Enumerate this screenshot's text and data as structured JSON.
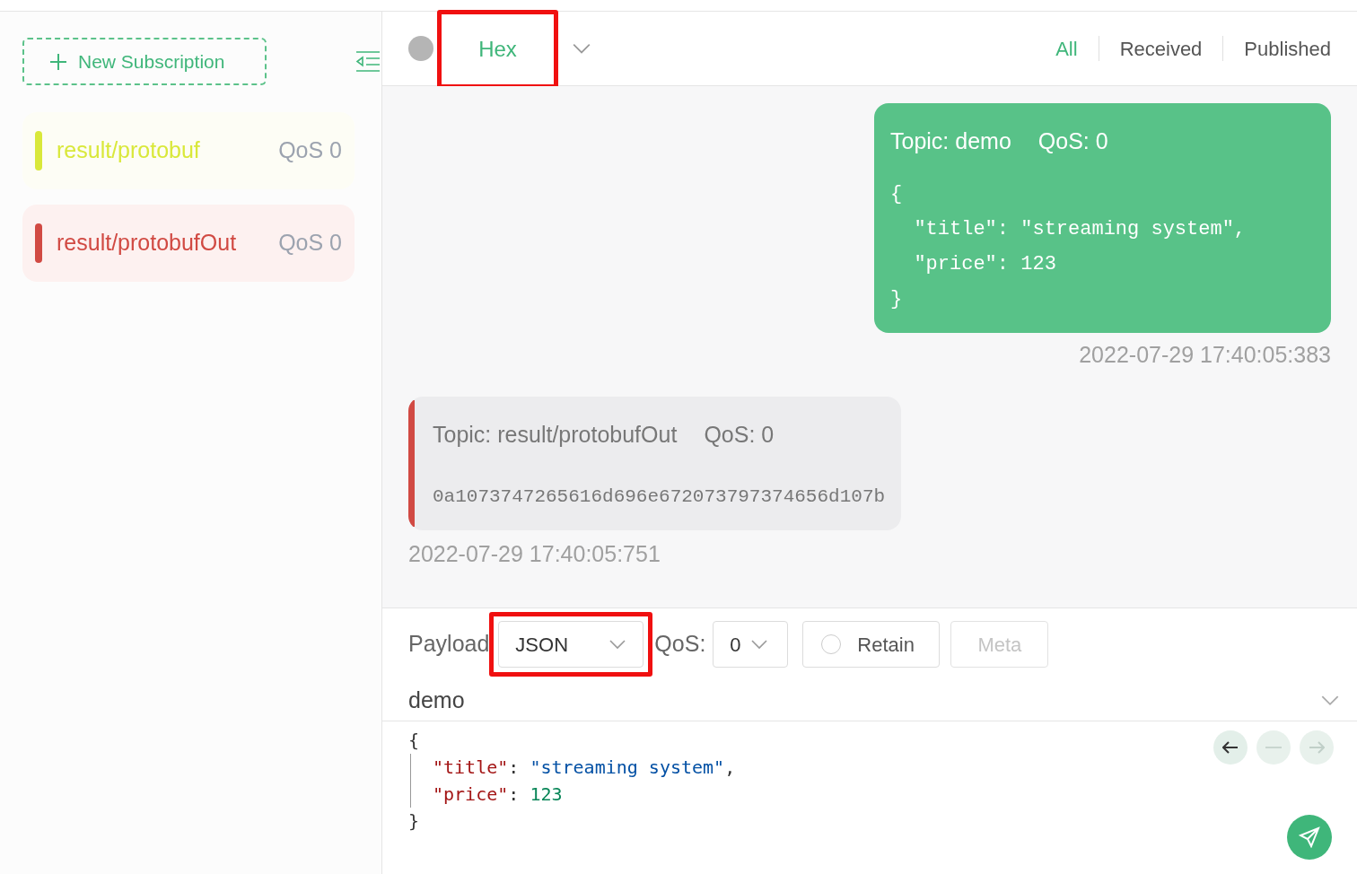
{
  "sidebar": {
    "new_subscription": "New Subscription",
    "subscriptions": [
      {
        "topic": "result/protobuf",
        "qos": "QoS 0",
        "color": "#d9e83a",
        "selected": false
      },
      {
        "topic": "result/protobufOut",
        "qos": "QoS 0",
        "color": "#d14a43",
        "selected": true
      }
    ]
  },
  "toolbar": {
    "format": "Hex",
    "format_annotated": true,
    "filters": [
      {
        "label": "All",
        "selected": true
      },
      {
        "label": "Received",
        "selected": false
      },
      {
        "label": "Published",
        "selected": false
      }
    ]
  },
  "messages": [
    {
      "kind": "sent",
      "topic": "Topic: demo",
      "qos": "QoS: 0",
      "payload": [
        "{",
        "  \"title\": \"streaming system\",",
        "  \"price\": 123",
        "}"
      ],
      "time": "2022-07-29 17:40:05:383"
    },
    {
      "kind": "received",
      "color": "#d14a43",
      "topic": "Topic: result/protobufOut",
      "qos": "QoS: 0",
      "payload": [
        "0a1073747265616d696e672073797374656d107b"
      ],
      "time": "2022-07-29 17:40:05:751"
    }
  ],
  "composer": {
    "payload_label": "Payload",
    "payload_format": "JSON",
    "payload_annotated": true,
    "qos_label": "QoS:",
    "qos": "0",
    "retain": {
      "label": "Retain",
      "checked": false
    },
    "meta": {
      "label": "Meta",
      "disabled": true
    },
    "topic": "demo",
    "editor": [
      {
        "guide": false,
        "tokens": [
          {
            "kind": "punct",
            "text": "{"
          }
        ]
      },
      {
        "guide": true,
        "tokens": [
          {
            "kind": "key",
            "text": "\"title\""
          },
          {
            "kind": "punct",
            "text": ": "
          },
          {
            "kind": "string",
            "text": "\"streaming system\""
          },
          {
            "kind": "punct",
            "text": ","
          }
        ]
      },
      {
        "guide": true,
        "tokens": [
          {
            "kind": "key",
            "text": "\"price\""
          },
          {
            "kind": "punct",
            "text": ": "
          },
          {
            "kind": "number",
            "text": "123"
          }
        ]
      },
      {
        "guide": false,
        "tokens": [
          {
            "kind": "punct",
            "text": "}"
          }
        ]
      }
    ]
  }
}
